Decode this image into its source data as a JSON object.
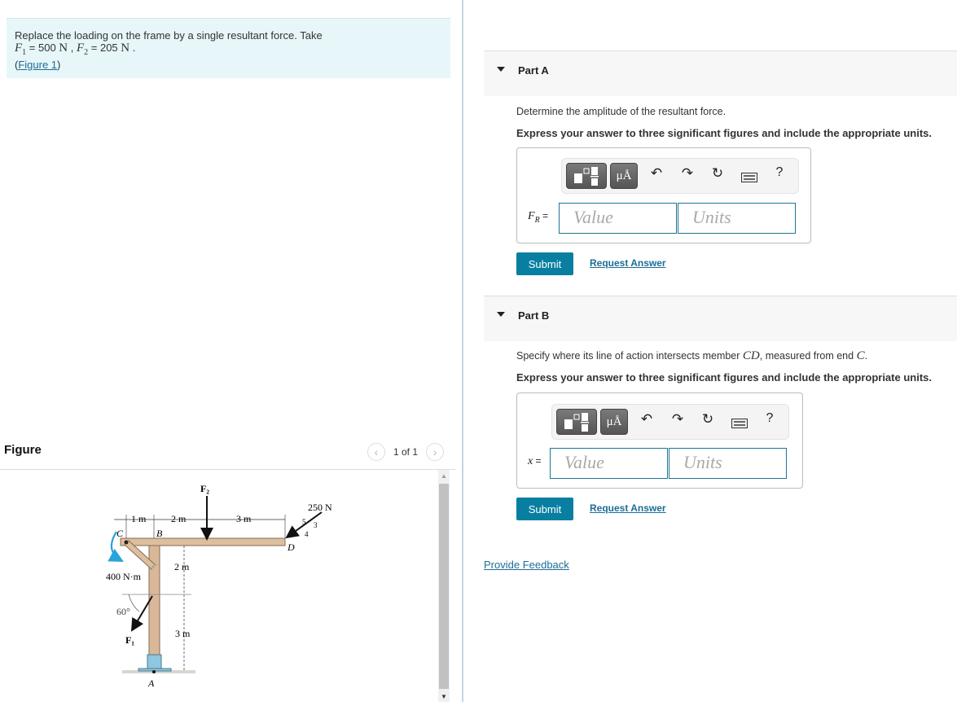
{
  "problem": {
    "statement": "Replace the loading on the frame by a single resultant force. Take",
    "f1_symbol": "F",
    "f1_sub": "1",
    "f1_value": " = 500 ",
    "f1_unit": "N",
    "sep": " , ",
    "f2_symbol": "F",
    "f2_sub": "2",
    "f2_value": " = 205 ",
    "f2_unit": "N",
    "end": " .",
    "figure_link": "Figure 1",
    "paren_open": "(",
    "paren_close": ")"
  },
  "figure_panel": {
    "title": "Figure",
    "pager_text": "1 of 1",
    "prev_icon": "‹",
    "next_icon": "›",
    "diagram": {
      "labels": {
        "f2": "F₂",
        "load_250": "250 N",
        "slope_5": "5",
        "slope_3": "3",
        "slope_4": "4",
        "dim_1m": "1 m",
        "dim_2m_top": "2 m",
        "dim_3m_top": "3 m",
        "point_c": "C",
        "point_b": "B",
        "point_d": "D",
        "point_a": "A",
        "dim_2m_side": "2 m",
        "dim_3m_side": "3 m",
        "moment": "400 N·m",
        "angle": "60°",
        "f1": "F₁"
      }
    }
  },
  "parts": [
    {
      "label": "Part A",
      "question": "Determine the amplitude of the resultant force.",
      "instruction": "Express your answer to three significant figures and include the appropriate units.",
      "lhs_symbol": "F",
      "lhs_sub": "R",
      "lhs_eq": " =",
      "value_placeholder": "Value",
      "units_placeholder": "Units",
      "submit_label": "Submit",
      "request_label": "Request Answer"
    },
    {
      "label": "Part B",
      "question_pre": "Specify where its line of action intersects member ",
      "question_math1": "CD",
      "question_mid": ", measured from end ",
      "question_math2": "C",
      "question_end": ".",
      "instruction": "Express your answer to three significant figures and include the appropriate units.",
      "lhs_symbol": "x",
      "lhs_eq": " =",
      "value_placeholder": "Value",
      "units_placeholder": "Units",
      "submit_label": "Submit",
      "request_label": "Request Answer"
    }
  ],
  "toolbar": {
    "units_btn": "μÅ",
    "undo_icon": "↶",
    "redo_icon": "↷",
    "reset_icon": "↻",
    "help_icon": "?"
  },
  "feedback_label": "Provide Feedback",
  "colors": {
    "accent": "#087fa1",
    "link": "#1c6e96",
    "problem_bg": "#e7f6f8",
    "field_border": "#1b7693"
  }
}
